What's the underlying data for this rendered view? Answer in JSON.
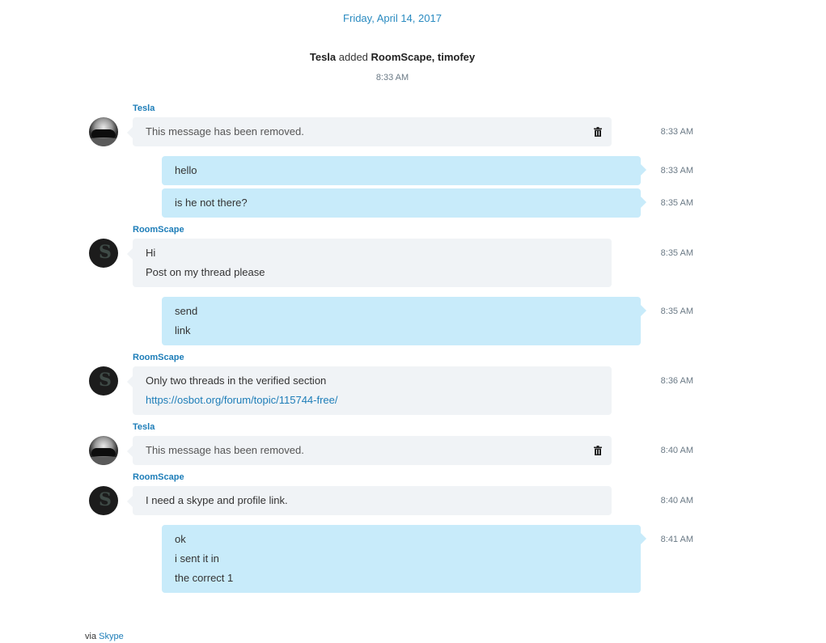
{
  "date_header": "Friday, April 14, 2017",
  "system": {
    "actor": "Tesla",
    "verb": "added",
    "targets": "RoomScape, timofey",
    "time": "8:33 AM"
  },
  "messages": [
    {
      "sender": "Tesla",
      "text": "This message has been removed.",
      "time": "8:33 AM"
    },
    {
      "text": "hello",
      "time": "8:33 AM"
    },
    {
      "text": "is he not there?",
      "time": "8:35 AM"
    },
    {
      "sender": "RoomScape",
      "lines": [
        "Hi",
        "Post on my thread please"
      ],
      "time": "8:35 AM"
    },
    {
      "lines": [
        "send",
        "link"
      ],
      "time": "8:35 AM"
    },
    {
      "sender": "RoomScape",
      "lines": [
        "Only two threads in the verified section",
        "https://osbot.org/forum/topic/115744-free/"
      ],
      "time": "8:36 AM"
    },
    {
      "sender": "Tesla",
      "text": "This message has been removed.",
      "time": "8:40 AM"
    },
    {
      "sender": "RoomScape",
      "text": "I need a skype and profile link.",
      "time": "8:40 AM"
    },
    {
      "lines": [
        "ok",
        "i sent it in",
        "the correct 1"
      ],
      "time": "8:41 AM"
    }
  ],
  "footer": {
    "prefix": "via",
    "link": "Skype"
  },
  "icons": {
    "trash": "trash-icon"
  },
  "colors": {
    "accent": "#1d7db8",
    "outgoing_bubble": "#c8ebfa",
    "incoming_bubble": "#f0f3f6"
  }
}
